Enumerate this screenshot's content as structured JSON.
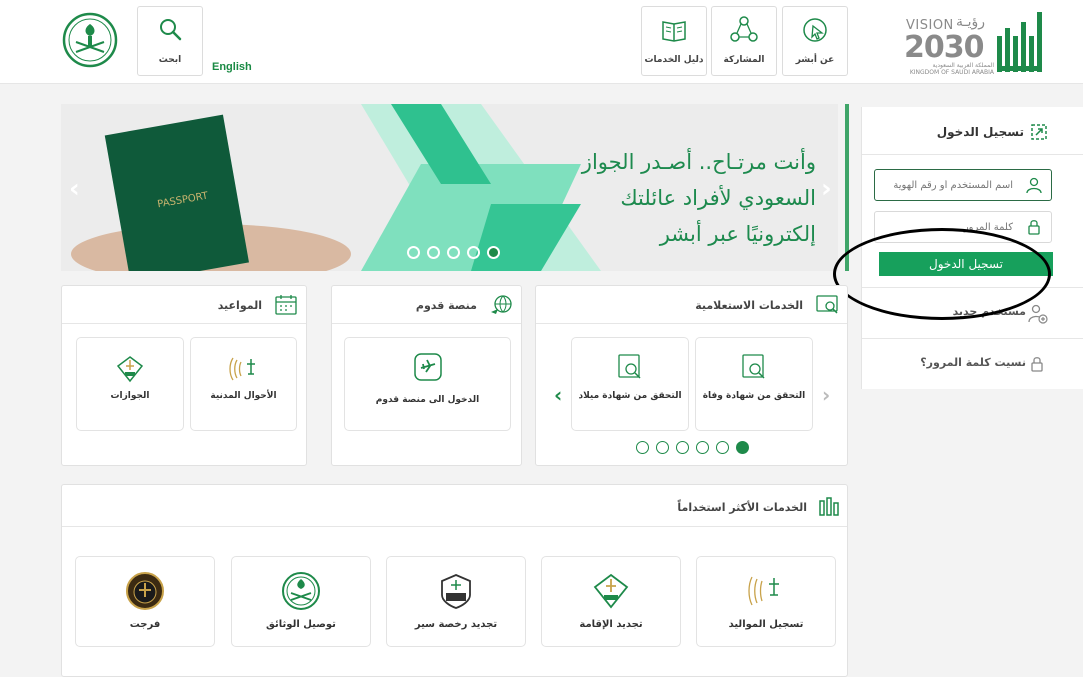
{
  "header": {
    "vision_word": "VISION",
    "vision_ar": "رؤيـة",
    "vision_year": "2030",
    "vision_sub_ar": "المملكة العربية السعودية",
    "vision_sub_en": "KINGDOM OF SAUDI ARABIA",
    "nav": [
      {
        "label": "عن أبشر",
        "icon": "cursor-click-icon"
      },
      {
        "label": "المشاركة",
        "icon": "share-network-icon"
      },
      {
        "label": "دليل الخدمات",
        "icon": "book-icon"
      }
    ],
    "english_label": "English",
    "search_label": "ابحث",
    "brand_color": "#1e8a4a"
  },
  "hero": {
    "lines": [
      "وأنت مرتـاح.. أصـدر الجواز",
      "السعودي لأفراد عائلتك",
      "إلكترونيًا عبر أبشر"
    ],
    "slides": 5,
    "active_slide": 5
  },
  "login": {
    "title": "تسجيل الدخول",
    "username_placeholder": "اسم المستخدم أو رقم الهوية",
    "password_placeholder": "كلمة المرور",
    "button": "تسجيل الدخول",
    "new_user": "مستخدم جديد",
    "forgot": "نسيت كلمة المرور؟"
  },
  "inquiry": {
    "title": "الخدمات الاستعلامية",
    "tiles": [
      {
        "label": "التحقق من شهادة وفاة"
      },
      {
        "label": "التحقق من شهادة ميلاد"
      }
    ],
    "pages": 6,
    "active_page": 6
  },
  "arrival": {
    "title": "منصة قدوم",
    "tile": "الدخول الى منصة قدوم"
  },
  "appointments": {
    "title": "المواعيد",
    "tiles": [
      {
        "label": "الأحوال المدنية"
      },
      {
        "label": "الجوازات"
      }
    ]
  },
  "most_used": {
    "title": "الخدمات الأكثر استخداماً",
    "tiles": [
      {
        "label": "تسجيل المواليد"
      },
      {
        "label": "تجديد الإقامة"
      },
      {
        "label": "تجديد رخصة سير"
      },
      {
        "label": "توصيل الوثائق"
      },
      {
        "label": "فرجت"
      }
    ]
  }
}
